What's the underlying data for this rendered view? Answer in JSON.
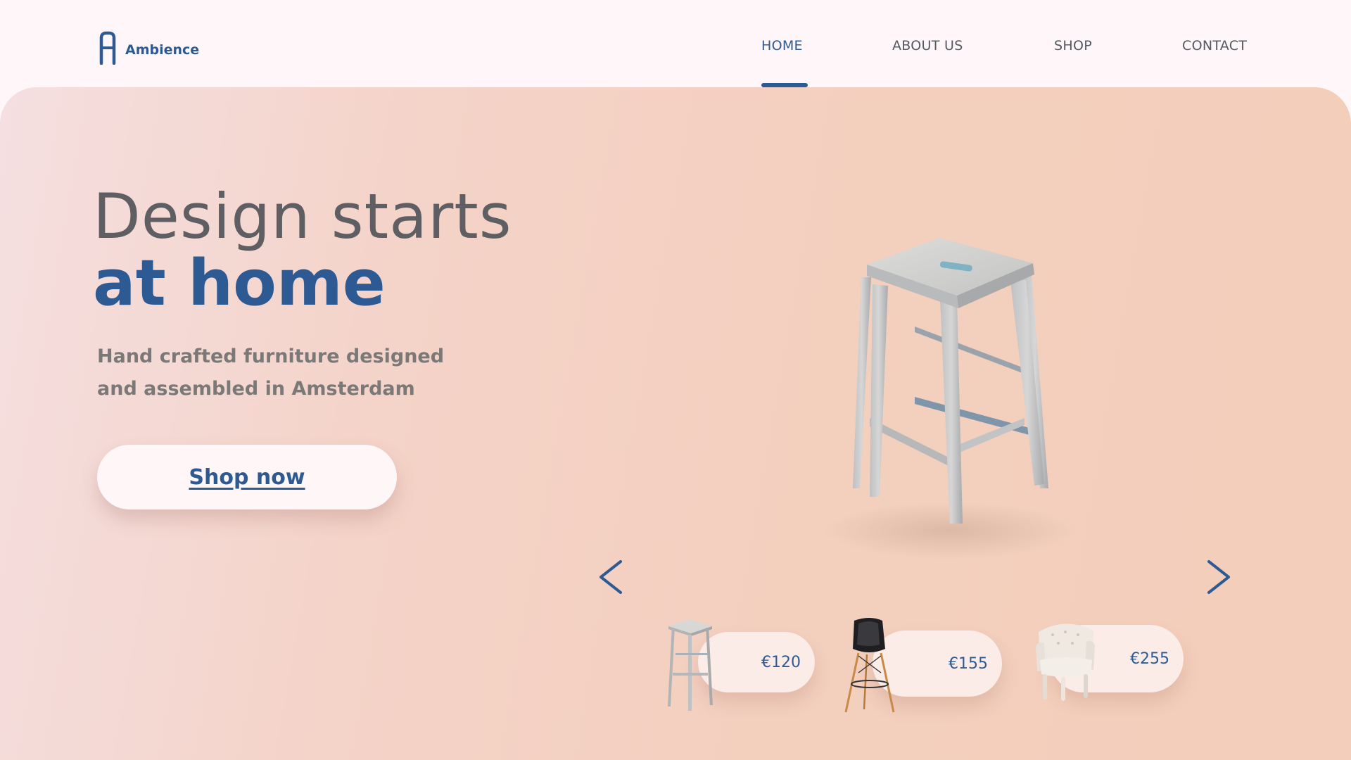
{
  "brand": {
    "name": "Ambience",
    "icon": "chair-logo-icon",
    "color": "#2e5a93"
  },
  "nav": {
    "items": [
      {
        "label": "HOME",
        "active": true
      },
      {
        "label": "ABOUT US",
        "active": false
      },
      {
        "label": "SHOP",
        "active": false
      },
      {
        "label": "CONTACT",
        "active": false
      }
    ]
  },
  "hero": {
    "headline_light": "Design starts",
    "headline_bold": "at home",
    "subtitle_line1": "Hand crafted furniture designed",
    "subtitle_line2": "and assembled in Amsterdam",
    "cta_label": "Shop now",
    "featured_product_icon": "wooden-bar-stool"
  },
  "carousel": {
    "prev_icon": "chevron-left-icon",
    "next_icon": "chevron-right-icon",
    "products": [
      {
        "price": "€120",
        "icon": "wooden-stool"
      },
      {
        "price": "€155",
        "icon": "black-bar-chair"
      },
      {
        "price": "€255",
        "icon": "white-armchair"
      }
    ]
  },
  "colors": {
    "accent": "#2e5a93",
    "hero_background": "#f3cfbe",
    "page_background": "#fef6f8",
    "text_muted": "#7b7977"
  }
}
